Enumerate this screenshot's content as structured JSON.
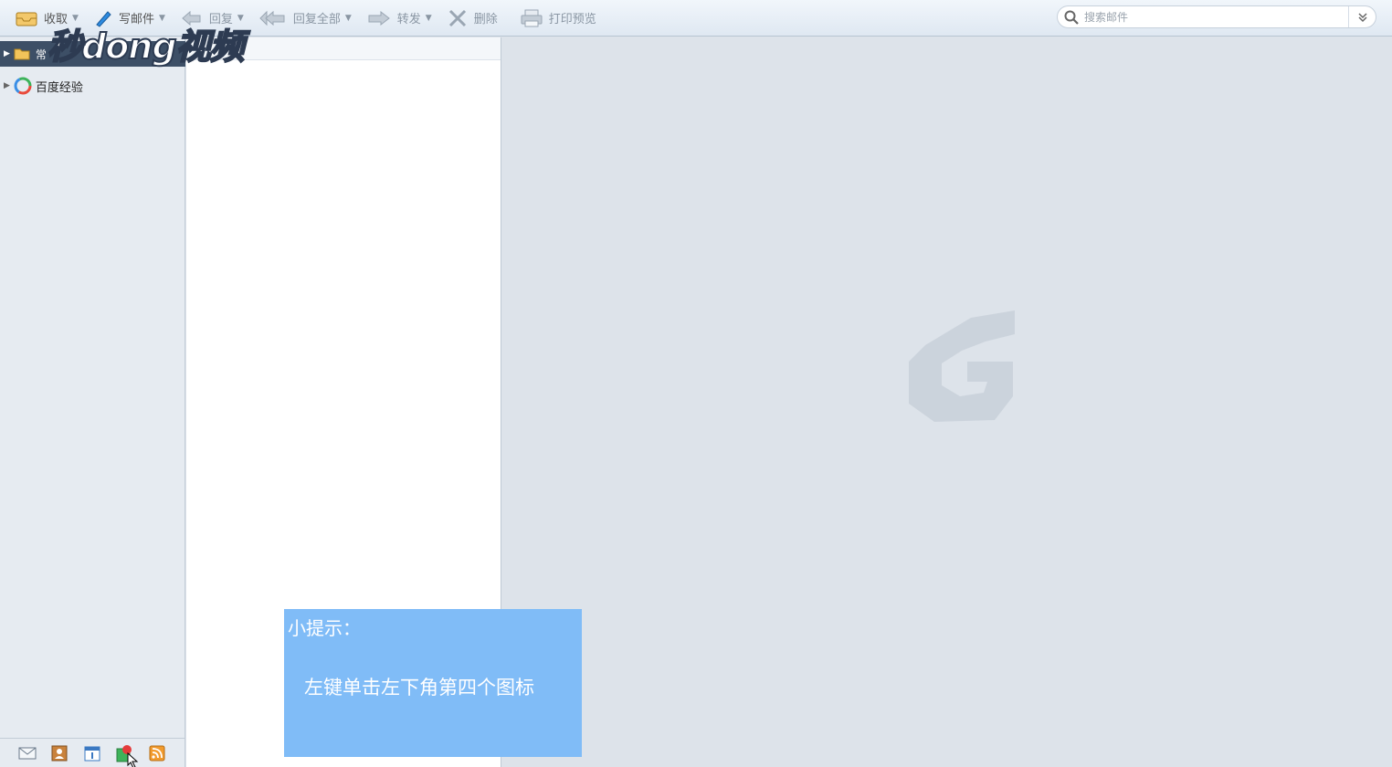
{
  "toolbar": {
    "receive_label": "收取",
    "compose_label": "写邮件",
    "reply_label": "回复",
    "reply_all_label": "回复全部",
    "forward_label": "转发",
    "delete_label": "删除",
    "print_preview_label": "打印预览"
  },
  "search": {
    "placeholder": "搜索邮件"
  },
  "sidebar": {
    "account_label": "常",
    "folders": [
      {
        "label": "百度经验"
      }
    ]
  },
  "watermark": {
    "text": "秒dong视频"
  },
  "tip": {
    "title": "小提示：",
    "body": "左键单击左下角第四个图标"
  },
  "colors": {
    "tip_background": "#80bcf7",
    "account_row": "#3d4f66",
    "preview_background": "#dde3ea"
  }
}
